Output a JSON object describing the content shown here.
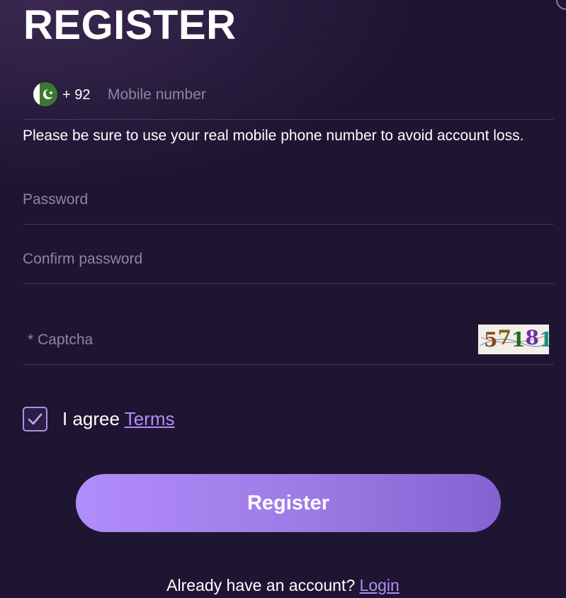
{
  "page": {
    "title": "REGISTER"
  },
  "phone": {
    "country_code": "+ 92",
    "placeholder": "Mobile number",
    "flag_icon": "pakistan-flag-icon"
  },
  "note": "Please be sure to use your real mobile phone number to avoid account loss.",
  "password": {
    "placeholder": "Password"
  },
  "confirm_password": {
    "placeholder": "Confirm password"
  },
  "captcha": {
    "placeholder": "* Captcha",
    "code": "57181",
    "digit_colors": [
      "#8b4a1c",
      "#8a5a1e",
      "#1f6b22",
      "#6c2fa3",
      "#1e8f7a"
    ]
  },
  "agree": {
    "checked": true,
    "text": "I agree",
    "terms_label": "Terms"
  },
  "register_button": {
    "label": "Register"
  },
  "login": {
    "prompt": "Already have an account?",
    "link_label": "Login"
  },
  "colors": {
    "background": "#1e1533",
    "accent": "#b48cf3",
    "button_start": "#b18cfb",
    "button_end": "#8462cf",
    "divider": "#433a5a",
    "placeholder": "#8e869f"
  }
}
